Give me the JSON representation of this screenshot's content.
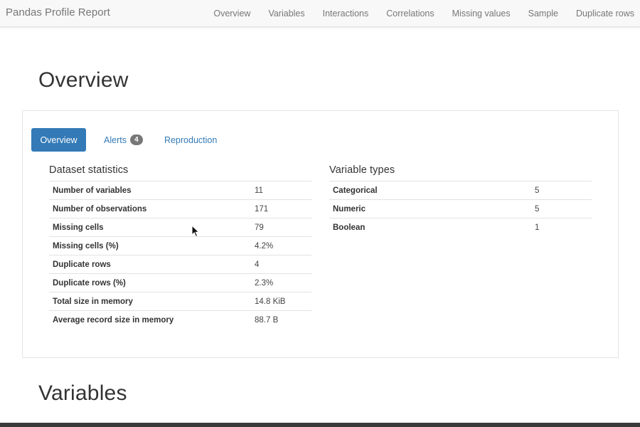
{
  "navbar": {
    "brand": "Pandas Profile Report",
    "links": [
      "Overview",
      "Variables",
      "Interactions",
      "Correlations",
      "Missing values",
      "Sample",
      "Duplicate rows"
    ]
  },
  "overview": {
    "title": "Overview",
    "tabs": {
      "overview": "Overview",
      "alerts": "Alerts",
      "alerts_count": "4",
      "reproduction": "Reproduction"
    },
    "dataset_statistics": {
      "title": "Dataset statistics",
      "rows": [
        {
          "label": "Number of variables",
          "value": "11"
        },
        {
          "label": "Number of observations",
          "value": "171"
        },
        {
          "label": "Missing cells",
          "value": "79"
        },
        {
          "label": "Missing cells (%)",
          "value": "4.2%"
        },
        {
          "label": "Duplicate rows",
          "value": "4"
        },
        {
          "label": "Duplicate rows (%)",
          "value": "2.3%"
        },
        {
          "label": "Total size in memory",
          "value": "14.8 KiB"
        },
        {
          "label": "Average record size in memory",
          "value": "88.7 B"
        }
      ]
    },
    "variable_types": {
      "title": "Variable types",
      "rows": [
        {
          "label": "Categorical",
          "value": "5"
        },
        {
          "label": "Numeric",
          "value": "5"
        },
        {
          "label": "Boolean",
          "value": "1"
        }
      ]
    }
  },
  "variables": {
    "title": "Variables"
  },
  "colors": {
    "primary": "#337ab7",
    "badge": "#777777",
    "navbar_bg": "#f8f8f8"
  }
}
